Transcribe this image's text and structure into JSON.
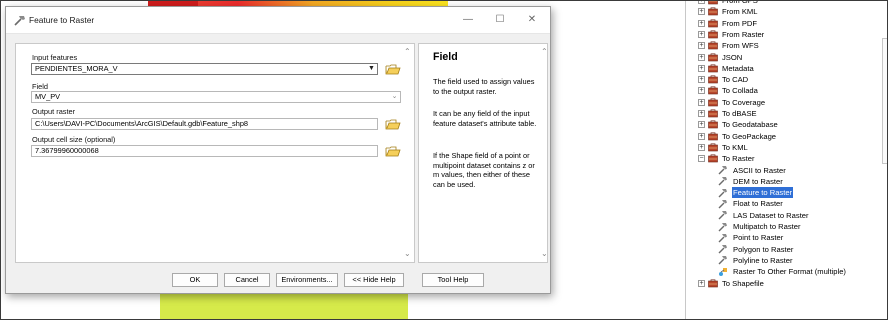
{
  "dialog": {
    "title": "Feature to Raster",
    "window_controls": {
      "minimize": "—",
      "maximize": "☐",
      "close": "✕"
    },
    "params": {
      "input_features_label": "Input features",
      "input_features_value": "PENDIENTES_MORA_V",
      "field_label": "Field",
      "field_value": "MV_PV",
      "output_raster_label": "Output raster",
      "output_raster_value": "C:\\Users\\DAVI-PC\\Documents\\ArcGIS\\Default.gdb\\Feature_shp8",
      "cell_size_label": "Output cell size (optional)",
      "cell_size_value": "7.36799960000068"
    },
    "help": {
      "title": "Field",
      "paragraphs": [
        "The field used to assign values to the output raster.",
        "It can be any field of the input feature dataset's attribute table.",
        "If the Shape field of a point or multipoint dataset contains z or m values, then either of these can be used."
      ]
    },
    "buttons": {
      "ok": "OK",
      "cancel": "Cancel",
      "environments": "Environments...",
      "hide_help": "<< Hide Help",
      "tool_help": "Tool Help"
    }
  },
  "catalog": {
    "toolsets": [
      "From GPS",
      "From KML",
      "From PDF",
      "From Raster",
      "From WFS",
      "JSON",
      "Metadata",
      "To CAD",
      "To Collada",
      "To Coverage",
      "To dBASE",
      "To Geodatabase",
      "To GeoPackage",
      "To KML",
      "To Raster"
    ],
    "to_raster_tools": [
      "ASCII to Raster",
      "DEM to Raster",
      "Feature to Raster",
      "Float to Raster",
      "LAS Dataset to Raster",
      "Multipatch to Raster",
      "Point to Raster",
      "Polygon to Raster",
      "Polyline to Raster",
      "Raster To Other Format (multiple)"
    ],
    "after": "To Shapefile",
    "selected_tool": "Feature to Raster",
    "selection_color": "#2f6fd6"
  }
}
